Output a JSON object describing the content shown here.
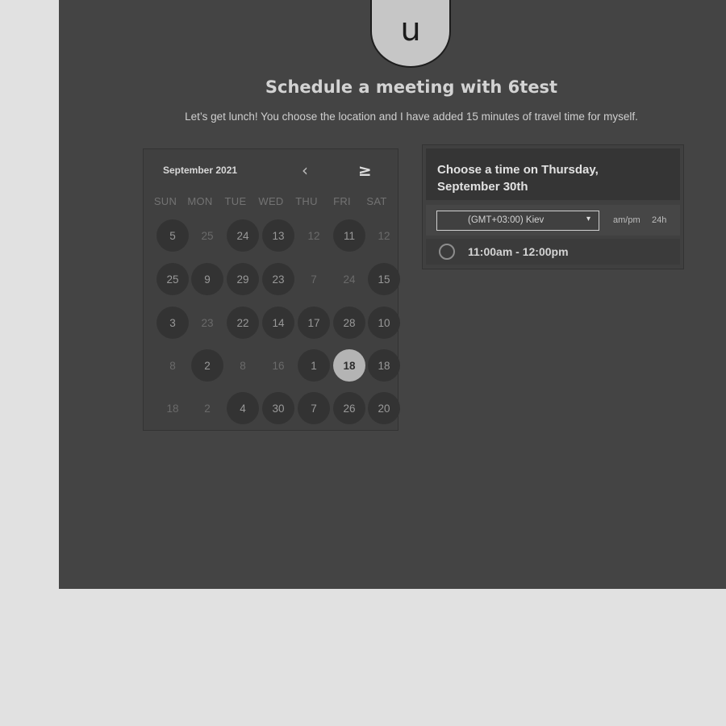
{
  "avatar": {
    "initial": "u"
  },
  "heading": {
    "title": "Schedule a meeting with 6test",
    "subtitle": "Let’s get lunch! You choose the location and I have added 15 minutes of travel time for myself."
  },
  "calendar": {
    "month_label": "September 2021",
    "prev_icon": "chevron-left-icon",
    "next_icon": "chevron-right-icon",
    "prev_glyph": "‹",
    "next_glyph": "≥",
    "weekdays": [
      "SUN",
      "MON",
      "TUE",
      "WED",
      "THU",
      "FRI",
      "SAT"
    ],
    "weeks": [
      [
        {
          "label": "5",
          "state": "available"
        },
        {
          "label": "25",
          "state": "disabled"
        },
        {
          "label": "24",
          "state": "available"
        },
        {
          "label": "13",
          "state": "available"
        },
        {
          "label": "12",
          "state": "disabled"
        },
        {
          "label": "11",
          "state": "available"
        },
        {
          "label": "12",
          "state": "disabled"
        }
      ],
      [
        {
          "label": "25",
          "state": "available"
        },
        {
          "label": "9",
          "state": "available"
        },
        {
          "label": "29",
          "state": "available"
        },
        {
          "label": "23",
          "state": "available"
        },
        {
          "label": "7",
          "state": "disabled"
        },
        {
          "label": "24",
          "state": "disabled"
        },
        {
          "label": "15",
          "state": "available"
        }
      ],
      [
        {
          "label": "3",
          "state": "available"
        },
        {
          "label": "23",
          "state": "disabled"
        },
        {
          "label": "22",
          "state": "available"
        },
        {
          "label": "14",
          "state": "available"
        },
        {
          "label": "17",
          "state": "available"
        },
        {
          "label": "28",
          "state": "available"
        },
        {
          "label": "10",
          "state": "available"
        }
      ],
      [
        {
          "label": "8",
          "state": "disabled"
        },
        {
          "label": "2",
          "state": "available"
        },
        {
          "label": "8",
          "state": "disabled"
        },
        {
          "label": "16",
          "state": "disabled"
        },
        {
          "label": "1",
          "state": "available"
        },
        {
          "label": "18",
          "state": "selected"
        },
        {
          "label": "18",
          "state": "available"
        }
      ],
      [
        {
          "label": "18",
          "state": "disabled"
        },
        {
          "label": "2",
          "state": "disabled"
        },
        {
          "label": "4",
          "state": "available"
        },
        {
          "label": "30",
          "state": "available"
        },
        {
          "label": "7",
          "state": "available"
        },
        {
          "label": "26",
          "state": "available"
        },
        {
          "label": "20",
          "state": "available"
        }
      ]
    ]
  },
  "times": {
    "header": "Choose a time on Thursday, September 30th",
    "timezone": {
      "value": "(GMT+03:00) Kiev",
      "caret_icon": "caret-down-icon",
      "caret_glyph": "▾"
    },
    "format_ampm": "am/pm",
    "format_24h": "24h",
    "slots": [
      {
        "label": "11:00am - 12:00pm"
      }
    ]
  },
  "colors": {
    "page_bg": "#e1e1e1",
    "panel_bg": "#444444",
    "available_day": "#333333",
    "selected_day": "#b4b4b4"
  }
}
